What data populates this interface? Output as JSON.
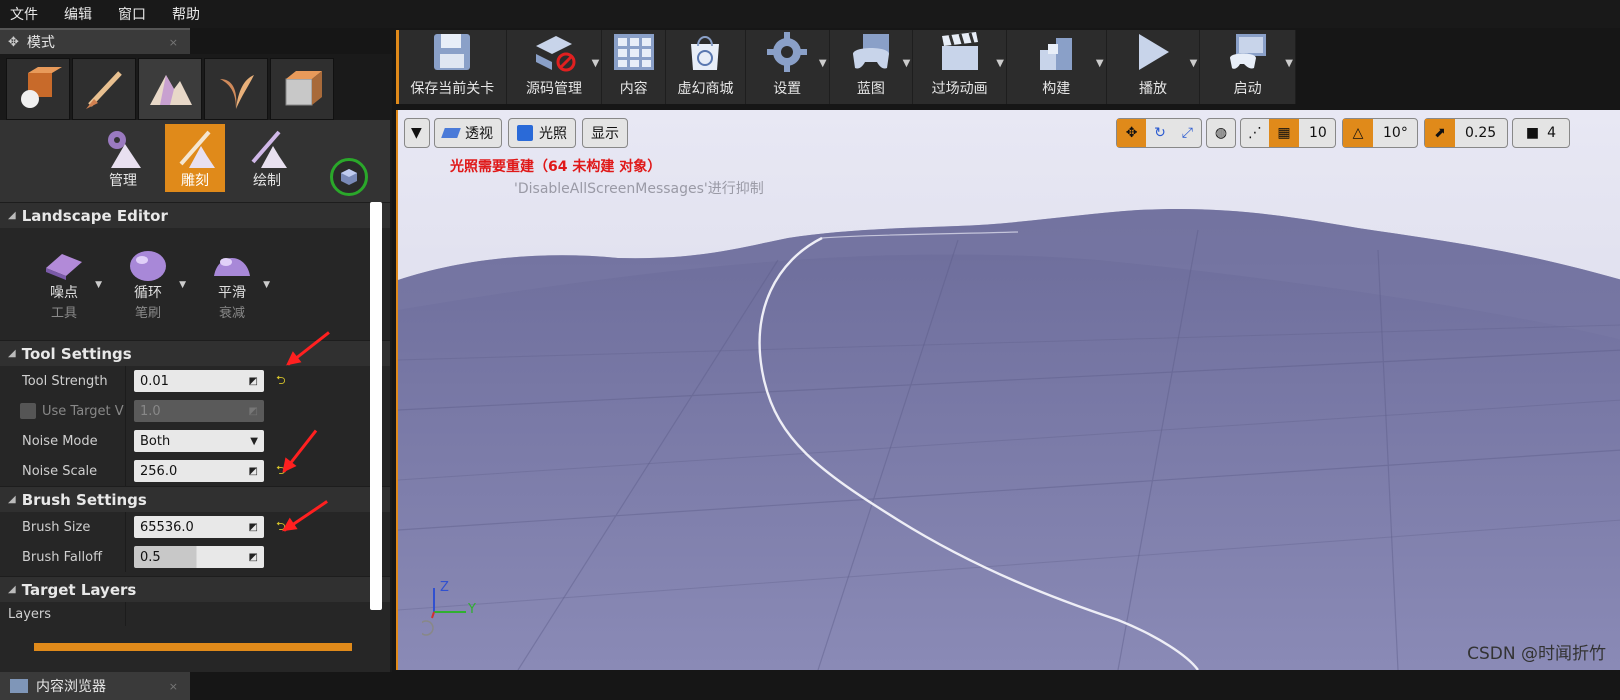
{
  "menu": [
    "文件",
    "编辑",
    "窗口",
    "帮助"
  ],
  "modes_tab": {
    "title": "模式",
    "close": "×"
  },
  "subtools": [
    {
      "label": "管理",
      "active": false
    },
    {
      "label": "雕刻",
      "active": true
    },
    {
      "label": "绘制",
      "active": false
    }
  ],
  "landscape_editor": {
    "title": "Landscape Editor",
    "tools": [
      {
        "label": "噪点",
        "sub": "工具"
      },
      {
        "label": "循环",
        "sub": "笔刷"
      },
      {
        "label": "平滑",
        "sub": "衰减"
      }
    ]
  },
  "tool_settings": {
    "title": "Tool Settings",
    "strength_label": "Tool Strength",
    "strength_value": "0.01",
    "target_label": "Use Target V",
    "target_value": "1.0",
    "noise_mode_label": "Noise Mode",
    "noise_mode_value": "Both",
    "noise_scale_label": "Noise Scale",
    "noise_scale_value": "256.0"
  },
  "brush_settings": {
    "title": "Brush Settings",
    "size_label": "Brush Size",
    "size_value": "65536.0",
    "falloff_label": "Brush Falloff",
    "falloff_value": "0.5"
  },
  "target_layers": {
    "title": "Target Layers",
    "layers_label": "Layers"
  },
  "content_tab": {
    "title": "内容浏览器",
    "close": "×"
  },
  "toolbar": {
    "save": "保存当前关卡",
    "source": "源码管理",
    "content": "内容",
    "market": "虚幻商城",
    "settings": "设置",
    "blueprint": "蓝图",
    "cinematics": "过场动画",
    "build": "构建",
    "play": "播放",
    "launch": "启动"
  },
  "viewport": {
    "perspective": "透视",
    "lit": "光照",
    "show": "显示",
    "light_warning": "光照需要重建（64 未构建 对象）",
    "suppress_msg": "'DisableAllScreenMessages'进行抑制",
    "grid": "10",
    "rotate": "10°",
    "scale": "0.25",
    "cam_speed": "4",
    "axis_z": "Z",
    "axis_y": "Y"
  },
  "watermark": "CSDN @时闻折竹",
  "colors": {
    "accent": "#e08a1a",
    "warn": "#e01818",
    "reset_arrow": "#d6c32a"
  }
}
